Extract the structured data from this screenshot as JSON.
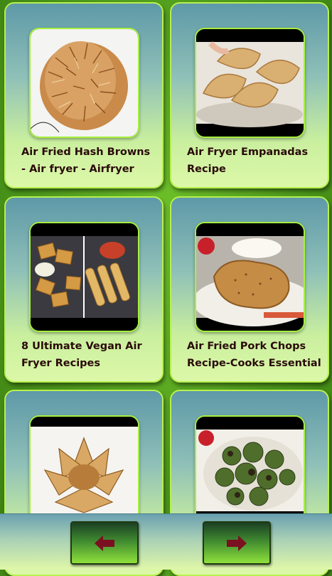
{
  "recipes": [
    {
      "title": "Air Fried Hash Browns - Air fryer - Airfryer",
      "thumbnail": "hash-browns-photo"
    },
    {
      "title": "Air Fryer Empanadas Recipe",
      "thumbnail": "empanadas-photo"
    },
    {
      "title": "8 Ultimate Vegan Air Fryer Recipes",
      "thumbnail": "vegan-snacks-photo"
    },
    {
      "title": "Air Fried Pork Chops Recipe-Cooks Essential",
      "thumbnail": "pork-chop-photo"
    },
    {
      "title": "",
      "thumbnail": "blooming-onion-photo"
    },
    {
      "title": "",
      "thumbnail": "brussels-sprouts-photo"
    }
  ],
  "footer": {
    "prev_icon": "arrow-left-icon",
    "next_icon": "arrow-right-icon",
    "arrow_color": "#7a1020"
  }
}
